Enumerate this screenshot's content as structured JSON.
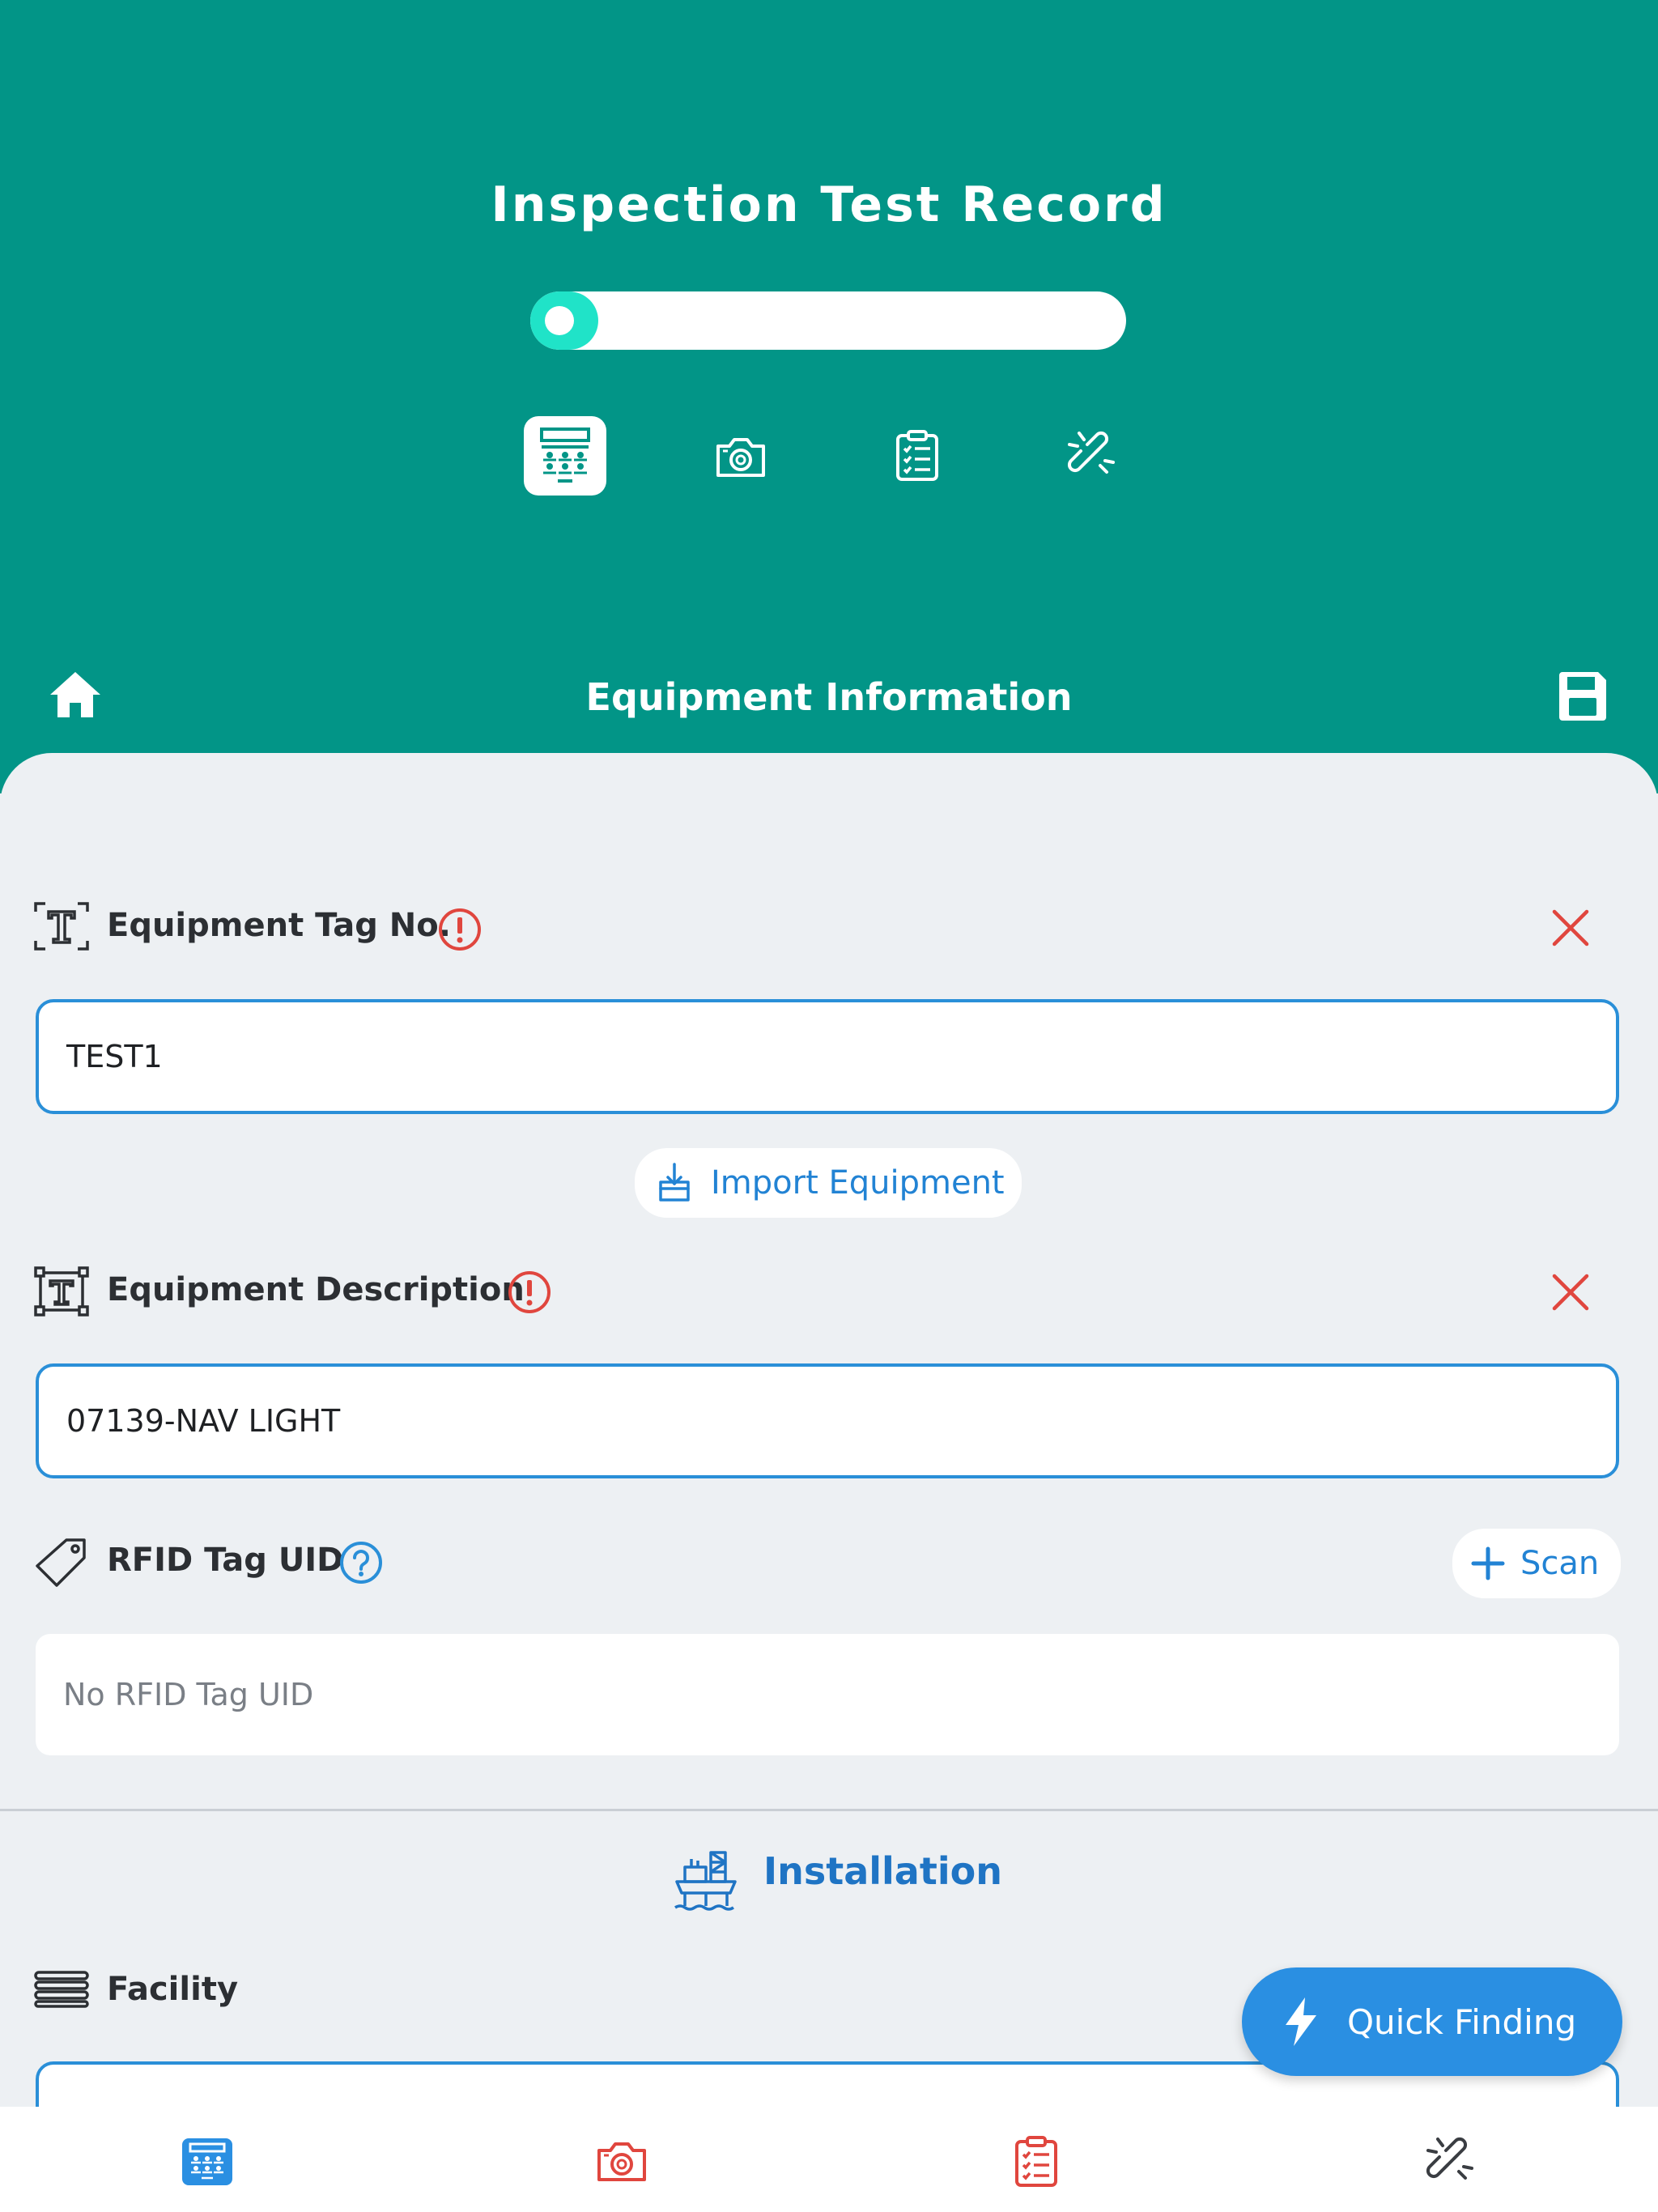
{
  "header": {
    "title": "Inspection Test Record",
    "progress_fraction": 0.11,
    "steps": [
      {
        "name": "equipment-info",
        "icon": "calculator-grid-icon",
        "active": true
      },
      {
        "name": "photos",
        "icon": "camera-icon",
        "active": false
      },
      {
        "name": "checklist",
        "icon": "clipboard-list-icon",
        "active": false
      },
      {
        "name": "connections",
        "icon": "broken-link-icon",
        "active": false
      }
    ],
    "section_title": "Equipment Information",
    "home_icon": "home-icon",
    "save_icon": "save-icon"
  },
  "form": {
    "tag_no": {
      "label": "Equipment Tag No.",
      "value": "TEST1",
      "icon": "text-tag-icon",
      "status_icon": "alert-circle-icon",
      "clear_icon": "close-icon"
    },
    "import_button": {
      "label": "Import Equipment",
      "icon": "import-box-icon"
    },
    "description": {
      "label": "Equipment Description",
      "value": "07139-NAV LIGHT",
      "icon": "text-frame-icon",
      "status_icon": "alert-circle-icon",
      "clear_icon": "close-icon"
    },
    "rfid": {
      "label": "RFID Tag UID",
      "placeholder": "No RFID Tag UID",
      "icon": "tag-icon",
      "help_icon": "help-circle-icon",
      "scan_label": "Scan",
      "scan_icon": "plus-icon"
    },
    "installation": {
      "title": "Installation",
      "icon": "offshore-platform-icon"
    },
    "facility": {
      "label": "Facility",
      "icon": "list-lines-icon"
    }
  },
  "fab": {
    "label": "Quick Finding",
    "icon": "lightning-icon"
  },
  "colors": {
    "header": "#029587",
    "accent": "#2a8fd8",
    "alert": "#e0463e",
    "progress": "#20e3c8"
  }
}
